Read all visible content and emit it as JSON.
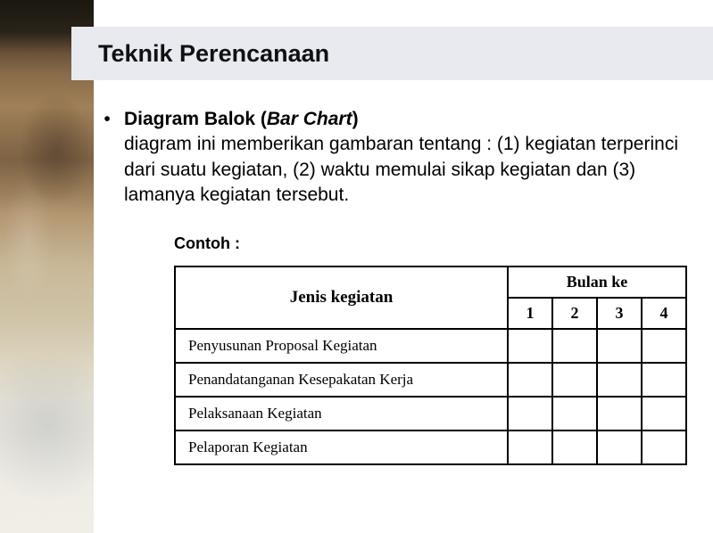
{
  "title": "Teknik Perencanaan",
  "bullet": {
    "mark": "•",
    "heading_pre": "Diagram Balok (",
    "heading_it": "Bar Chart",
    "heading_post": ")",
    "body": "diagram ini memberikan gambaran tentang : (1) kegiatan terperinci dari suatu kegiatan, (2) waktu memulai sikap kegiatan dan (3) lamanya kegiatan tersebut."
  },
  "contoh_label": "Contoh :",
  "table": {
    "header_activity": "Jenis kegiatan",
    "header_month": "Bulan ke",
    "months": [
      "1",
      "2",
      "3",
      "4"
    ],
    "rows": [
      "Penyusunan Proposal Kegiatan",
      "Penandatanganan Kesepakatan Kerja",
      "Pelaksanaan Kegiatan",
      "Pelaporan Kegiatan"
    ]
  }
}
